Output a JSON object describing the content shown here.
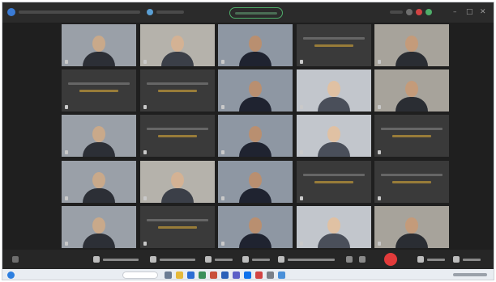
{
  "window": {
    "title": "",
    "tab_title": "",
    "session_chip": ""
  },
  "participants": [
    {
      "name": "",
      "subtitle": "",
      "video": true
    },
    {
      "name": "",
      "subtitle": "",
      "video": true
    },
    {
      "name": "",
      "subtitle": "",
      "video": true
    },
    {
      "name": "",
      "subtitle": "",
      "video": false
    },
    {
      "name": "",
      "subtitle": "",
      "video": true
    },
    {
      "name": "",
      "subtitle": "",
      "video": false
    },
    {
      "name": "",
      "subtitle": "",
      "video": false
    },
    {
      "name": "",
      "subtitle": "",
      "video": true
    },
    {
      "name": "",
      "subtitle": "",
      "video": true
    },
    {
      "name": "",
      "subtitle": "",
      "video": true
    },
    {
      "name": "",
      "subtitle": "",
      "video": true
    },
    {
      "name": "",
      "subtitle": "",
      "video": false
    },
    {
      "name": "",
      "subtitle": "",
      "video": true
    },
    {
      "name": "",
      "subtitle": "",
      "video": true
    },
    {
      "name": "",
      "subtitle": "",
      "video": false
    },
    {
      "name": "",
      "subtitle": "",
      "video": true
    },
    {
      "name": "",
      "subtitle": "",
      "video": true
    },
    {
      "name": "",
      "subtitle": "",
      "video": true
    },
    {
      "name": "",
      "subtitle": "",
      "video": false
    },
    {
      "name": "",
      "subtitle": "",
      "video": false
    },
    {
      "name": "",
      "subtitle": "",
      "video": true
    },
    {
      "name": "",
      "subtitle": "",
      "video": false
    },
    {
      "name": "",
      "subtitle": "",
      "video": true
    },
    {
      "name": "",
      "subtitle": "",
      "video": true
    },
    {
      "name": "",
      "subtitle": "",
      "video": true
    }
  ],
  "toolbar": {
    "mic_label": "",
    "camera_label": "",
    "share_label": "",
    "record_label": "",
    "reactions_label": "",
    "participants_label": "",
    "more_label": ""
  },
  "taskbar": {
    "search_placeholder": ""
  },
  "colors": {
    "background": "#1f1f1f",
    "tile": "#3a3a3a",
    "name_caption": "#b8933a",
    "leave_button": "#e23b3b",
    "session_chip_border": "#4fae6a"
  }
}
